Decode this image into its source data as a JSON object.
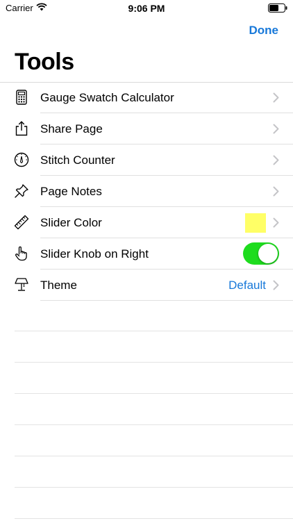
{
  "status": {
    "carrier": "Carrier",
    "time": "9:06 PM"
  },
  "nav": {
    "done_label": "Done"
  },
  "title": "Tools",
  "colors": {
    "accent": "#1778d9",
    "swatch": "#ffff66",
    "toggle_on": "#1edc1e"
  },
  "rows": [
    {
      "label": "Gauge Swatch Calculator",
      "icon": "calculator-icon"
    },
    {
      "label": "Share Page",
      "icon": "share-icon"
    },
    {
      "label": "Stitch Counter",
      "icon": "stitch-counter-icon"
    },
    {
      "label": "Page Notes",
      "icon": "pin-icon"
    },
    {
      "label": "Slider Color",
      "icon": "ruler-icon"
    },
    {
      "label": "Slider Knob on Right",
      "icon": "pointing-hand-icon",
      "toggle_on": true
    },
    {
      "label": "Theme",
      "icon": "lamp-icon",
      "value": "Default"
    }
  ]
}
